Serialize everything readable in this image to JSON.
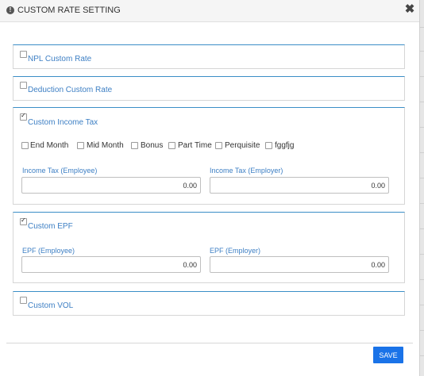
{
  "dialog": {
    "title": "CUSTOM RATE SETTING",
    "info_icon": "!",
    "close_icon": "✖",
    "close_icon_name": "close-icon"
  },
  "panels": {
    "npl": {
      "label": "NPL Custom Rate",
      "checked": false
    },
    "deduction": {
      "label": "Deduction Custom Rate",
      "checked": false
    },
    "income_tax": {
      "label": "Custom Income Tax",
      "checked": true,
      "options": [
        {
          "label": "End Month",
          "checked": false
        },
        {
          "label": "Mid Month",
          "checked": false
        },
        {
          "label": "Bonus",
          "checked": false
        },
        {
          "label": "Part Time",
          "checked": false
        },
        {
          "label": "Perquisite",
          "checked": false
        },
        {
          "label": "fggfjg",
          "checked": false
        }
      ],
      "employee_label": "Income Tax (Employee)",
      "employee_value": "0.00",
      "employer_label": "Income Tax (Employer)",
      "employer_value": "0.00"
    },
    "epf": {
      "label": "Custom EPF",
      "checked": true,
      "employee_label": "EPF (Employee)",
      "employee_value": "0.00",
      "employer_label": "EPF (Employer)",
      "employer_value": "0.00"
    },
    "vol": {
      "label": "Custom VOL",
      "checked": false
    }
  },
  "footer": {
    "save_label": "SAVE"
  },
  "colors": {
    "accent": "#3d7fc4",
    "panel_border_top": "#3b8ec7",
    "save_button": "#1a73e8",
    "header_bg": "#f5f5f5"
  }
}
